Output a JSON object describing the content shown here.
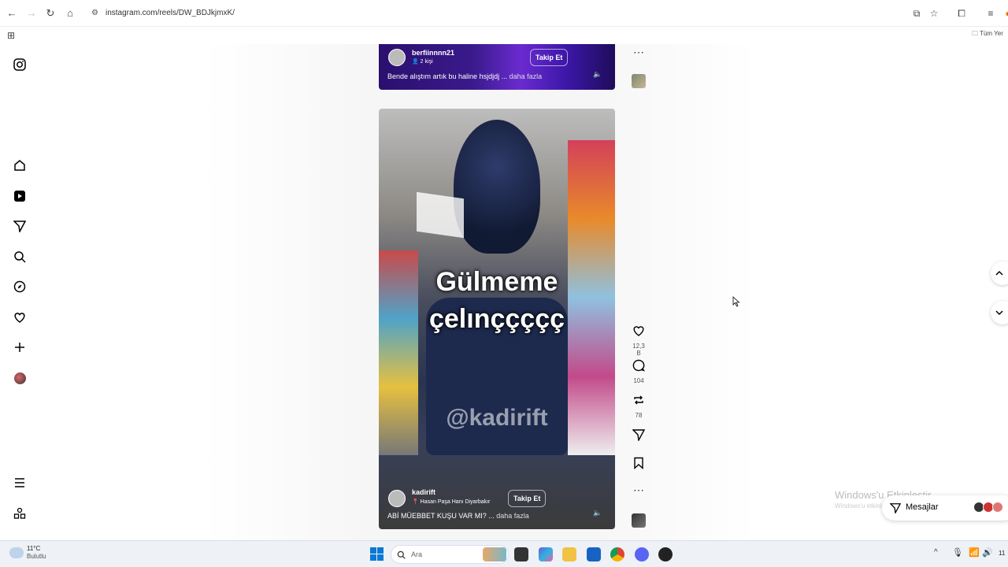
{
  "browser": {
    "url": "instagram.com/reels/DW_BDJkjmxK/",
    "bookmark_folder": "Tüm Yer"
  },
  "reel_prev": {
    "username": "berfiinnnn21",
    "sub": "2 kişi",
    "follow_label": "Takip Et",
    "caption": "Bende alıştım artık bu haline hsjdjdj ...",
    "more": "daha fazla"
  },
  "reel_current": {
    "overlay_line1": "Gülmeme",
    "overlay_line2": "çelınççççç",
    "watermark": "@kadirift",
    "username": "kadirift",
    "location": "Hasan Paşa Hanı Diyarbakır",
    "follow_label": "Takip Et",
    "caption": "ABİ MÜEBBET KUŞU VAR MI? ...",
    "more": "daha fazla"
  },
  "actions": {
    "likes": "12,3 B",
    "comments": "104",
    "reposts": "78"
  },
  "windows": {
    "activate_title": "Windows'u Etkinleştir",
    "activate_sub": "Windows'u etkinleştirmek için Ayarlar",
    "messages_label": "Mesajlar"
  },
  "taskbar": {
    "temp": "11°C",
    "weather": "Bulutlu",
    "search_placeholder": "Ara",
    "clock": "11"
  },
  "colors": {
    "accent": "#0095f6",
    "reel_gradient": "#3a1a8c"
  }
}
